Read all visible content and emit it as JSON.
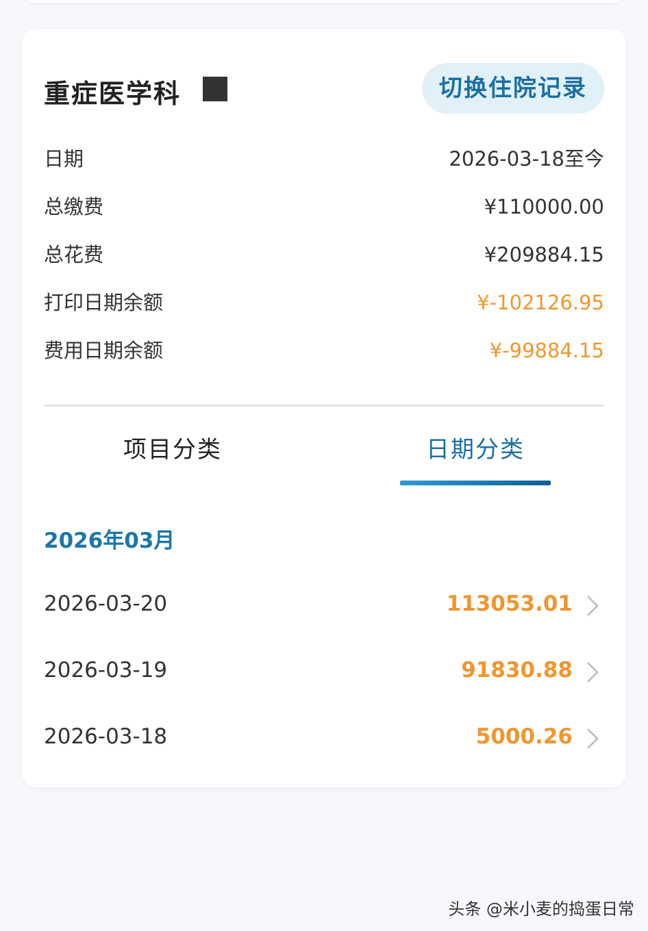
{
  "header": {
    "department": "重症医学科",
    "switch_button": "切换住院记录"
  },
  "summary": [
    {
      "label": "日期",
      "value": "2026-03-18至今",
      "highlight": false
    },
    {
      "label": "总缴费",
      "value": "¥110000.00",
      "highlight": false
    },
    {
      "label": "总花费",
      "value": "¥209884.15",
      "highlight": false
    },
    {
      "label": "打印日期余额",
      "value": "¥-102126.95",
      "highlight": true
    },
    {
      "label": "费用日期余额",
      "value": "¥-99884.15",
      "highlight": true
    }
  ],
  "tabs": {
    "category": "项目分类",
    "date": "日期分类",
    "active": "date"
  },
  "month": "2026年03月",
  "daily": [
    {
      "date": "2026-03-20",
      "amount": "113053.01"
    },
    {
      "date": "2026-03-19",
      "amount": "91830.88"
    },
    {
      "date": "2026-03-18",
      "amount": "5000.26"
    }
  ],
  "watermark": "头条 @米小麦的捣蛋日常",
  "colors": {
    "accent": "#1b6fa3",
    "amount": "#f0962e",
    "button_bg": "#e2f0f8"
  },
  "icons": {
    "row_arrow": "chevron-right-icon"
  }
}
